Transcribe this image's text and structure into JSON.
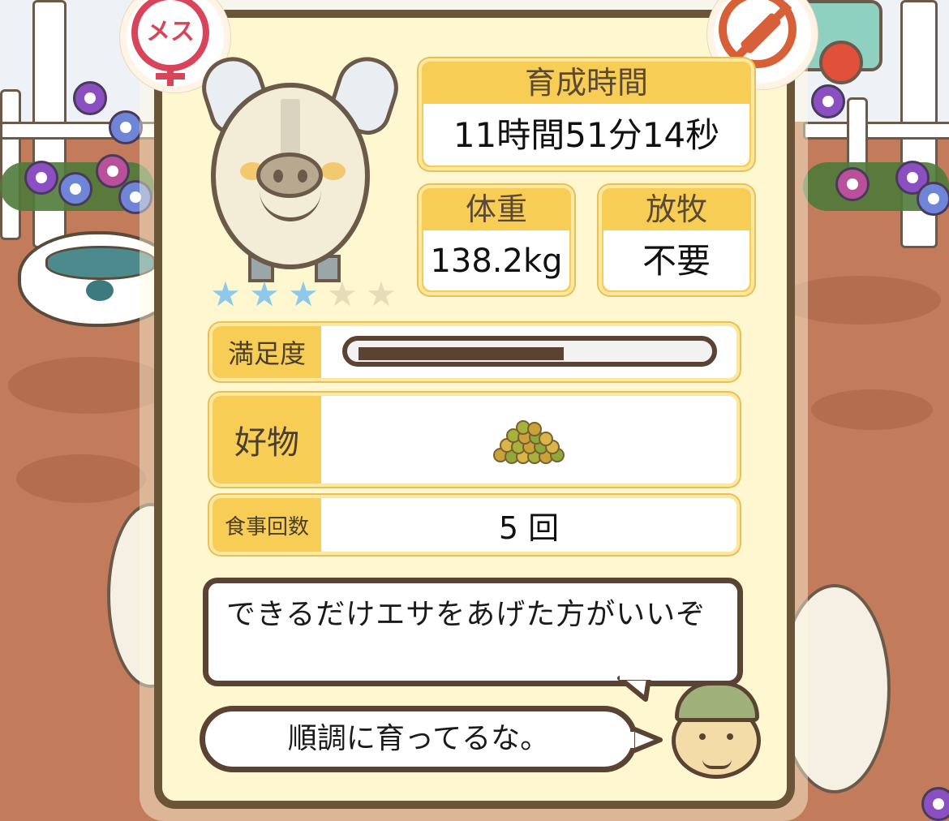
{
  "badges": {
    "gender_label": "メス",
    "gender_icon": "female-symbol-icon",
    "vaccine_icon": "syringe-crossed-icon"
  },
  "growth_time": {
    "label": "育成時間",
    "value": "11時間51分14秒"
  },
  "weight": {
    "label": "体重",
    "value": "138.2kg"
  },
  "grazing": {
    "label": "放牧",
    "value": "不要"
  },
  "rating": {
    "stars": [
      "★",
      "★",
      "★",
      "★",
      "★"
    ],
    "filled": 3,
    "filled_color": "#8ec9ea",
    "empty_color": "#e7dcb8"
  },
  "satisfaction": {
    "label": "満足度",
    "level": 0.6
  },
  "favorite_food": {
    "label": "好物",
    "icon": "feed-pellets-icon"
  },
  "meal_count": {
    "label": "食事回数",
    "value": "5 回"
  },
  "advice": {
    "text": "できるだけエサをあげた方がいいぞ"
  },
  "comment": {
    "text": "順調に育ってるな。"
  },
  "colors": {
    "panel_accent": "#f7cd55",
    "card_bg": "#fff7cf",
    "border": "#6b5538"
  }
}
